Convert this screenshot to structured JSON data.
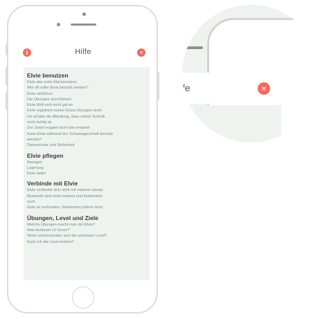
{
  "header": {
    "title": "Hilfe",
    "info_icon_glyph": "i",
    "close_icon_glyph": "×"
  },
  "colors": {
    "accent": "#ef6c61",
    "section_title": "#3d3d3d",
    "link_text": "#6e8a86",
    "content_bg": "#eff3f0"
  },
  "sections": [
    {
      "title": "Elvie benutzen",
      "items": [
        "Elvie das erste Mal benutzen",
        "Wie oft sollte Elvie benutzt werden?",
        "Elvie einführen",
        "Die Übungen durchführen",
        "Elvie fühlt sich nicht gut an",
        "Elvie registriert meine Drück-Übungen nicht",
        "Ich erhalte die Mitteilung, dass meine Technik",
        "nicht richtig ist",
        "Der Juwel reagiert nicht wie erwartet",
        "Kann Elvie während der Schwangerschaft benutzt",
        "werden?",
        "Datenschutz und Sicherheit"
      ]
    },
    {
      "title": "Elvie pflegen",
      "items": [
        "Reinigen",
        "Lagerung",
        "Elvie laden"
      ]
    },
    {
      "title": "Verbinde mit Elvie",
      "items": [
        "Elvie verbindet sich nicht mit meinem Handy",
        "Bluetooth wird nicht erkannt und funktioniert",
        "nicht",
        "Elvie ist verbunden, funktioniert jedoch nicht"
      ]
    },
    {
      "title": "Übungen, Level und Ziele",
      "items": [
        "Welche Übungen macht man mit Elvie?",
        "Was bedeutet LV-Score?",
        "Worin unterscheiden sich die einzelnen Level?",
        "Kann ich die Level ändern?"
      ]
    }
  ],
  "zoom": {
    "title_fragment": "fe",
    "close_icon_glyph": "×"
  }
}
